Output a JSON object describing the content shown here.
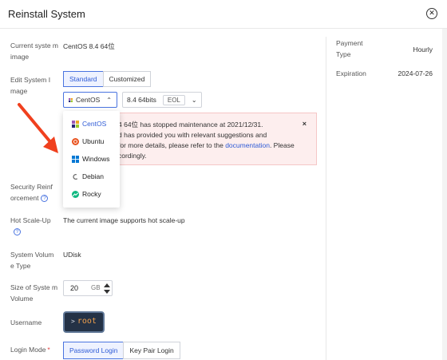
{
  "header": {
    "title": "Reinstall System",
    "close_glyph": "✕"
  },
  "form": {
    "current_image": {
      "label": "Current syste m image",
      "value": "CentOS 8.4 64位"
    },
    "edit_image": {
      "label": "Edit System I mage",
      "tabs": [
        {
          "label": "Standard",
          "active": true
        },
        {
          "label": "Customized",
          "active": false
        }
      ],
      "os_select": {
        "value": "CentOS",
        "arrow": "⌃"
      },
      "version_select": {
        "value": "8.4 64bits",
        "tag": "EOL",
        "arrow": "⌄"
      }
    },
    "alert": {
      "line1": "4 64位 has stopped maintenance at 2021/12/31.",
      "line2": "d has provided you with relevant suggestions and",
      "line3_prefix": "for more details, please refer to the ",
      "line3_link": "documentation",
      "line3_suffix": ". Please",
      "line4": "cordingly.",
      "close_glyph": "×"
    },
    "os_dropdown": [
      {
        "label": "CentOS",
        "icon": "centos-icon",
        "selected": true,
        "color": "#9b59b6"
      },
      {
        "label": "Ubuntu",
        "icon": "ubuntu-icon",
        "selected": false,
        "color": "#e95420"
      },
      {
        "label": "Windows",
        "icon": "windows-icon",
        "selected": false,
        "color": "#0078d4"
      },
      {
        "label": "Debian",
        "icon": "debian-icon",
        "selected": false,
        "color": "#a80030"
      },
      {
        "label": "Rocky",
        "icon": "rocky-icon",
        "selected": false,
        "color": "#10b981"
      }
    ],
    "security": {
      "label": "Security Reinf orcement"
    },
    "hot_scale": {
      "label": "Hot Scale-Up",
      "value": "The current image supports hot scale-up"
    },
    "volume_type": {
      "label": "System Volum e Type",
      "value": "UDisk"
    },
    "volume_size": {
      "label": "Size of Syste m Volume",
      "value": "20",
      "unit": "GB"
    },
    "username": {
      "label": "Username",
      "prompt": ">",
      "value": "root"
    },
    "login_mode": {
      "label": "Login Mode",
      "required_mark": "*",
      "options": [
        {
          "label": "Password Login",
          "active": true
        },
        {
          "label": "Key Pair Login",
          "active": false
        }
      ]
    }
  },
  "sidebar": {
    "payment_type": {
      "label": "Payment Type",
      "value": "Hourly"
    },
    "expiration": {
      "label": "Expiration",
      "value": "2024-07-26"
    }
  },
  "colors": {
    "accent": "#4a74e0",
    "alert_bg": "#fdeeee",
    "arrow": "#f0401e"
  }
}
